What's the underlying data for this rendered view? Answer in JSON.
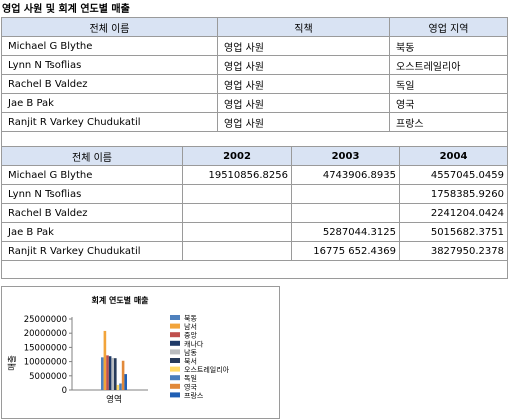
{
  "report": {
    "title": "영업 사원 및 회계 연도별 매출"
  },
  "table1": {
    "headers": [
      "전체 이름",
      "직책",
      "영업 지역"
    ],
    "rows": [
      [
        "Michael G Blythe",
        "영업 사원",
        "북동"
      ],
      [
        "Lynn N Tsoflias",
        "영업 사원",
        "오스트레일리아"
      ],
      [
        "Rachel B Valdez",
        "영업 사원",
        "독일"
      ],
      [
        "Jae B Pak",
        "영업 사원",
        "영국"
      ],
      [
        "Ranjit R Varkey Chudukatil",
        "영업 사원",
        "프랑스"
      ]
    ]
  },
  "table2": {
    "headers": [
      "전체 이름",
      "2002",
      "2003",
      "2004"
    ],
    "rows": [
      [
        "Michael G Blythe",
        "19510856.8256",
        "4743906.8935",
        "4557045.0459"
      ],
      [
        "Lynn N Tsoflias",
        "",
        "",
        "1758385.9260"
      ],
      [
        "Rachel B Valdez",
        "",
        "",
        "2241204.0424"
      ],
      [
        "Jae B Pak",
        "",
        "5287044.3125",
        "5015682.3751"
      ],
      [
        "Ranjit R Varkey Chudukatil",
        "",
        "16775 652.4369",
        "3827950.2378"
      ]
    ]
  },
  "chart_data": {
    "type": "bar",
    "title": "회계 연도별 매출",
    "ylabel": "매출",
    "xlabel": "",
    "categories": [
      "영역"
    ],
    "ylim": [
      0,
      25000000
    ],
    "yticks": [
      "25000000",
      "20000000",
      "15000000",
      "10000000",
      "5000000",
      "0"
    ],
    "legend_position": "right",
    "series": [
      {
        "name": "북동",
        "color": "#4f81bd",
        "values": [
          11500000
        ]
      },
      {
        "name": "남서",
        "color": "#f2a43a",
        "values": [
          20800000
        ]
      },
      {
        "name": "중앙",
        "color": "#c0504d",
        "values": [
          12200000
        ]
      },
      {
        "name": "캐나다",
        "color": "#1f3a68",
        "values": [
          11900000
        ]
      },
      {
        "name": "남동",
        "color": "#b9bcbf",
        "values": [
          11300000
        ]
      },
      {
        "name": "북서",
        "color": "#263a59",
        "values": [
          11200000
        ]
      },
      {
        "name": "오스트레일리아",
        "color": "#ffd966",
        "values": [
          1800000
        ]
      },
      {
        "name": "독일",
        "color": "#4a7ebb",
        "values": [
          2300000
        ]
      },
      {
        "name": "영국",
        "color": "#e1893a",
        "values": [
          10300000
        ]
      },
      {
        "name": "프랑스",
        "color": "#1f5fb4",
        "values": [
          5600000
        ]
      }
    ]
  }
}
